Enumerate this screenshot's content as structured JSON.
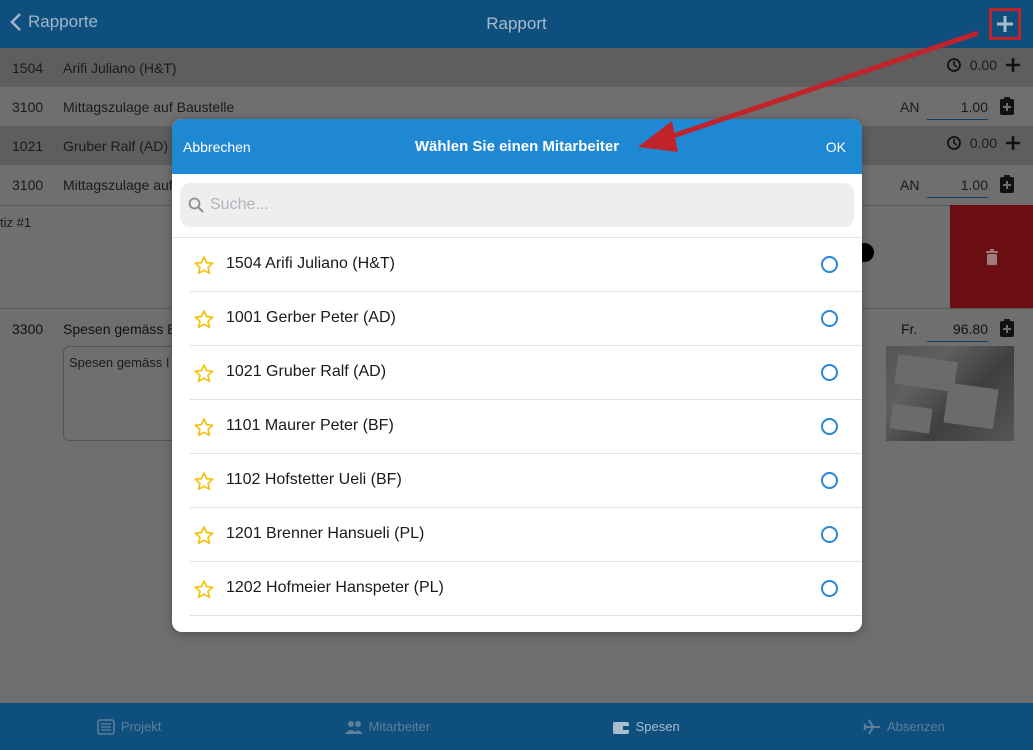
{
  "topbar": {
    "back_label": "Rapporte",
    "title": "Rapport"
  },
  "rows": [
    {
      "code": "1504",
      "desc": "Arifi Juliano (H&T)",
      "value": "0.00"
    },
    {
      "code": "3100",
      "desc": "Mittagszulage auf Baustelle",
      "unit": "AN",
      "amount": "1.00"
    },
    {
      "code": "1021",
      "desc": "Gruber Ralf (AD)",
      "value": "0.00"
    },
    {
      "code": "3100",
      "desc": "Mittagszulage auf",
      "unit": "AN",
      "amount": "1.00"
    }
  ],
  "notiz_label": "tiz #1",
  "spesen": {
    "code": "3300",
    "desc": "Spesen gemäss B",
    "unit": "Fr.",
    "amount": "96.80",
    "note_text": "Spesen gemäss I"
  },
  "tabs": [
    {
      "label": "Projekt",
      "icon": "list-icon"
    },
    {
      "label": "Mitarbeiter",
      "icon": "people-icon"
    },
    {
      "label": "Spesen",
      "icon": "wallet-icon"
    },
    {
      "label": "Absenzen",
      "icon": "plane-icon"
    }
  ],
  "modal": {
    "cancel_label": "Abbrechen",
    "title": "Wählen Sie einen Mitarbeiter",
    "ok_label": "OK",
    "search_placeholder": "Suche...",
    "employees": [
      "1504 Arifi Juliano (H&T)",
      "1001 Gerber Peter (AD)",
      "1021 Gruber Ralf (AD)",
      "1101 Maurer Peter (BF)",
      "1102 Hofstetter Ueli (BF)",
      "1201 Brenner Hansueli (PL)",
      "1202 Hofmeier Hanspeter (PL)"
    ]
  },
  "colors": {
    "header_blue": "#1f88d3",
    "navbar_dim": "#0f4f7e",
    "star_yellow": "#f4c20d",
    "radio_blue": "#2b86d6",
    "annotation_red": "#c0242a",
    "delete_red": "#6b0e12"
  }
}
